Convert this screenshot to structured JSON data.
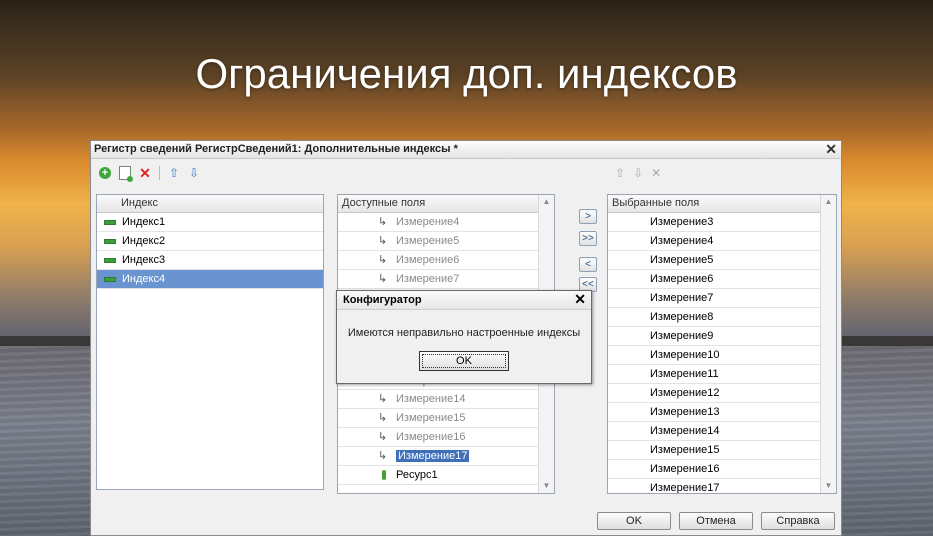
{
  "slide": {
    "title": "Ограничения доп. индексов"
  },
  "window": {
    "title": "Регистр сведений РегистрСведений1: Дополнительные индексы *",
    "close_glyph": "✕"
  },
  "index_panel": {
    "header": "Индекс",
    "items": [
      {
        "label": "Индекс1",
        "selected": false
      },
      {
        "label": "Индекс2",
        "selected": false
      },
      {
        "label": "Индекс3",
        "selected": false
      },
      {
        "label": "Индекс4",
        "selected": true
      }
    ]
  },
  "available_panel": {
    "header": "Доступные поля",
    "items_top": [
      "Измерение4",
      "Измерение5",
      "Измерение6",
      "Измерение7"
    ],
    "partial_item": "Измерение13",
    "items_bottom": [
      "Измерение14",
      "Измерение15",
      "Измерение16"
    ],
    "selected_item": "Измерение17",
    "resource_item": "Ресурс1"
  },
  "move_buttons": {
    "add": ">",
    "add_all": ">>",
    "remove": "<",
    "remove_all": "<<"
  },
  "selected_panel": {
    "header": "Выбранные поля",
    "items": [
      "Измерение3",
      "Измерение4",
      "Измерение5",
      "Измерение6",
      "Измерение7",
      "Измерение8",
      "Измерение9",
      "Измерение10",
      "Измерение11",
      "Измерение12",
      "Измерение13",
      "Измерение14",
      "Измерение15",
      "Измерение16",
      "Измерение17"
    ]
  },
  "footer": {
    "ok": "OK",
    "cancel": "Отмена",
    "help": "Справка"
  },
  "dialog": {
    "title": "Конфигуратор",
    "message": "Имеются неправильно настроенные индексы",
    "ok": "OK",
    "close_glyph": "✕"
  },
  "icons": {
    "add": "add-icon",
    "copy": "copy-icon",
    "delete": "delete-icon",
    "move_up": "move-up-icon",
    "move_down": "move-down-icon"
  }
}
